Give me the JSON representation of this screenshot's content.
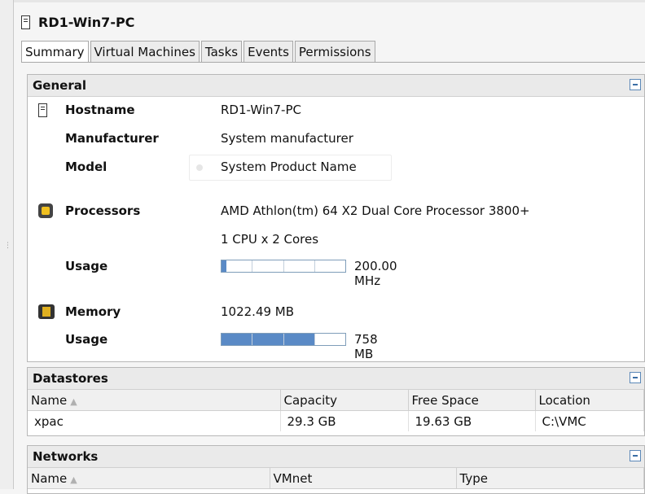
{
  "header": {
    "title": "RD1-Win7-PC",
    "icon": "host-icon"
  },
  "tabs": [
    {
      "label": "Summary",
      "active": true
    },
    {
      "label": "Virtual Machines",
      "active": false
    },
    {
      "label": "Tasks",
      "active": false
    },
    {
      "label": "Events",
      "active": false
    },
    {
      "label": "Permissions",
      "active": false
    }
  ],
  "general": {
    "title": "General",
    "hostname_label": "Hostname",
    "hostname": "RD1-Win7-PC",
    "manufacturer_label": "Manufacturer",
    "manufacturer": "System manufacturer",
    "model_label": "Model",
    "model": "System Product Name",
    "processors_label": "Processors",
    "processor": "AMD Athlon(tm) 64 X2 Dual Core Processor 3800+",
    "cpu_cores": "1 CPU x 2 Cores",
    "cpu_usage_label": "Usage",
    "cpu_usage_value": "200.00 MHz",
    "cpu_usage_fraction": 0.04,
    "memory_label": "Memory",
    "memory_total": "1022.49 MB",
    "memory_usage_label": "Usage",
    "memory_usage_value": "758 MB",
    "memory_usage_fraction": 0.75
  },
  "datastores": {
    "title": "Datastores",
    "columns": [
      "Name",
      "Capacity",
      "Free Space",
      "Location"
    ],
    "rows": [
      [
        "xpac",
        "29.3 GB",
        "19.63 GB",
        "C:\\VMC"
      ]
    ]
  },
  "networks": {
    "title": "Networks",
    "columns": [
      "Name",
      "VMnet",
      "Type"
    ]
  },
  "colors": {
    "bar_fill": "#5a8ac6",
    "bar_border": "#7f9db9",
    "panel_header": "#eaeaea"
  }
}
